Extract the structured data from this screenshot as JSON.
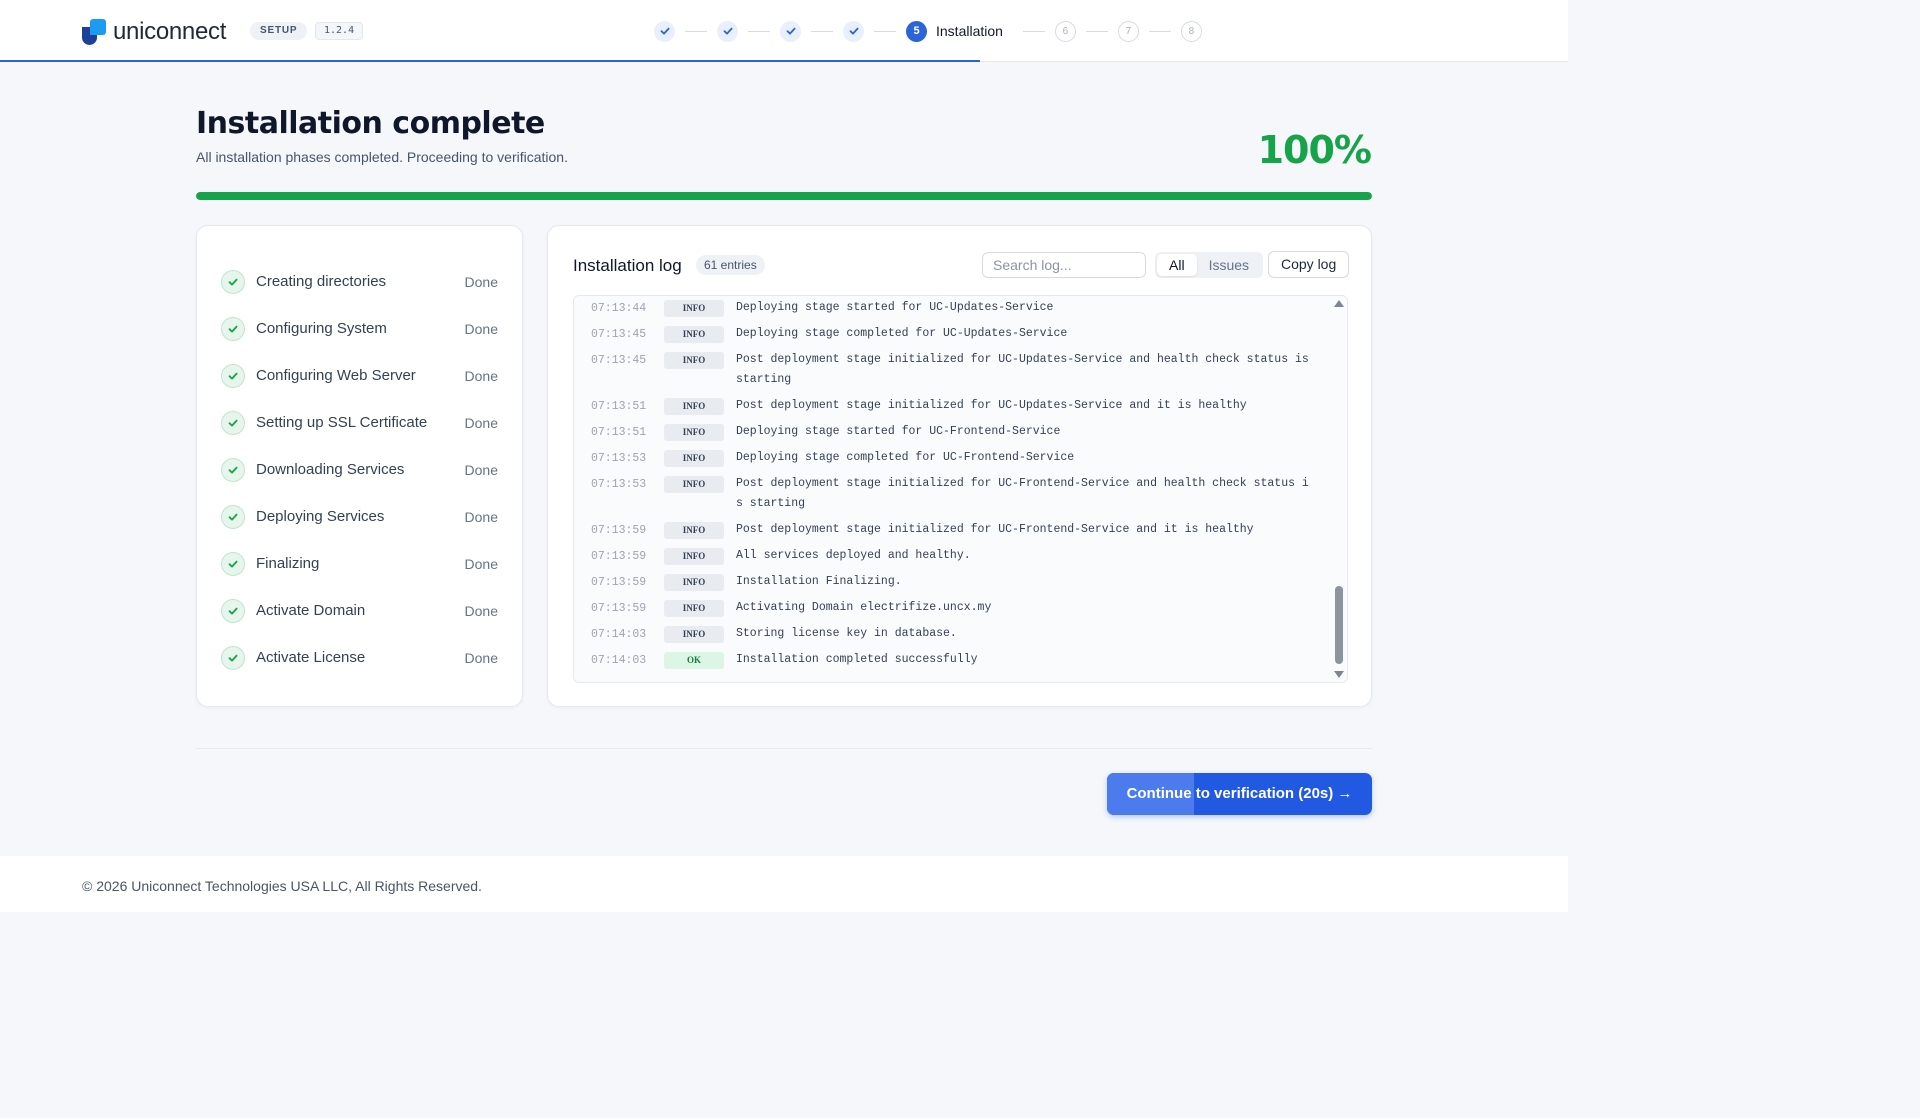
{
  "header": {
    "brand": "uniconnect",
    "setup_badge": "SETUP",
    "version": "1.2.4",
    "steps": [
      {
        "state": "done"
      },
      {
        "state": "done"
      },
      {
        "state": "done"
      },
      {
        "state": "done"
      },
      {
        "state": "current",
        "number": "5",
        "label": "Installation"
      },
      {
        "state": "todo",
        "number": "6"
      },
      {
        "state": "todo",
        "number": "7"
      },
      {
        "state": "todo",
        "number": "8"
      }
    ]
  },
  "main": {
    "title": "Installation complete",
    "subtitle": "All installation phases completed. Proceeding to verification.",
    "percent": "100%",
    "progress_fraction": 1.0,
    "progress_color": "#17a34a"
  },
  "phases": [
    {
      "name": "Creating directories",
      "status": "Done"
    },
    {
      "name": "Configuring System",
      "status": "Done"
    },
    {
      "name": "Configuring Web Server",
      "status": "Done"
    },
    {
      "name": "Setting up SSL Certificate",
      "status": "Done"
    },
    {
      "name": "Downloading Services",
      "status": "Done"
    },
    {
      "name": "Deploying Services",
      "status": "Done"
    },
    {
      "name": "Finalizing",
      "status": "Done"
    },
    {
      "name": "Activate Domain",
      "status": "Done"
    },
    {
      "name": "Activate License",
      "status": "Done"
    }
  ],
  "log": {
    "title": "Installation log",
    "count": "61 entries",
    "search_placeholder": "Search log...",
    "filter_all": "All",
    "filter_issues": "Issues",
    "copy_label": "Copy log",
    "entries": [
      {
        "time": "07:13:44",
        "level": "INFO",
        "message": "Deploying stage started for UC-Updates-Service"
      },
      {
        "time": "07:13:45",
        "level": "INFO",
        "message": "Deploying stage completed for UC-Updates-Service"
      },
      {
        "time": "07:13:45",
        "level": "INFO",
        "message": "Post deployment stage initialized for UC-Updates-Service and health check status is starting"
      },
      {
        "time": "07:13:51",
        "level": "INFO",
        "message": "Post deployment stage initialized for UC-Updates-Service and it is healthy"
      },
      {
        "time": "07:13:51",
        "level": "INFO",
        "message": "Deploying stage started for UC-Frontend-Service"
      },
      {
        "time": "07:13:53",
        "level": "INFO",
        "message": "Deploying stage completed for UC-Frontend-Service"
      },
      {
        "time": "07:13:53",
        "level": "INFO",
        "message": "Post deployment stage initialized for UC-Frontend-Service and health check status is starting"
      },
      {
        "time": "07:13:59",
        "level": "INFO",
        "message": "Post deployment stage initialized for UC-Frontend-Service and it is healthy"
      },
      {
        "time": "07:13:59",
        "level": "INFO",
        "message": "All services deployed and healthy."
      },
      {
        "time": "07:13:59",
        "level": "INFO",
        "message": "Installation Finalizing."
      },
      {
        "time": "07:13:59",
        "level": "INFO",
        "message": "Activating Domain electrifize.uncx.my"
      },
      {
        "time": "07:14:03",
        "level": "INFO",
        "message": "Storing license key in database."
      },
      {
        "time": "07:14:03",
        "level": "OK",
        "message": "Installation completed successfully"
      }
    ]
  },
  "cta_label": "Continue to verification (20s) →",
  "footer": "© 2026 Uniconnect Technologies USA LLC, All Rights Reserved."
}
